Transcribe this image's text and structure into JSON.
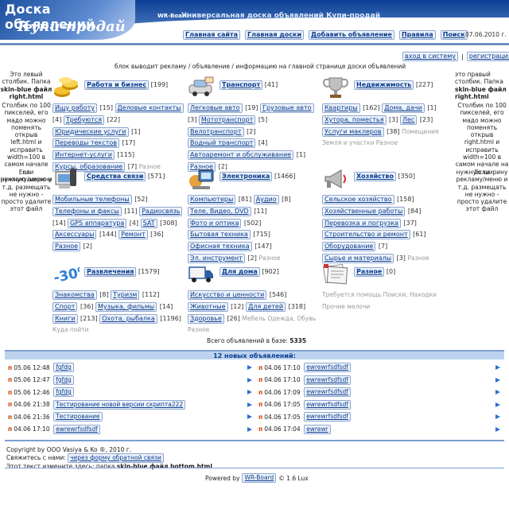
{
  "header": {
    "logo_line1": "Доска объявлений",
    "logo_line2": "Купи-продай",
    "brand": "WR-Board",
    "slogan": "Универсальная доска объявлений Купи-продай",
    "date": "07.06.2010 г.",
    "nav": [
      "Главная сайта",
      "Главная доски",
      "Добавить объявление",
      "Правила",
      "Поиск"
    ]
  },
  "auth": {
    "login": "вход в систему",
    "sep": "|",
    "register": "регистрация"
  },
  "left_column": {
    "text1": "Это левый\nстолбик. Папка\nskin-blue файл\nright.html",
    "text2": "Столбик по 100\nпикселей, его\nмадо можно\nпоменять открыв\nleft.html и\nисправить\nwidth=100 в\nсамом начале на\nнужную ширину",
    "text3": "Если\nрекламу/меню и\nт.д. размещать\nне нужно -\nпросто удалите\nэтот файл"
  },
  "right_column": {
    "text1": "это правый\nстолбик. Папка\nskin-blue файл\nright.html",
    "text2": "Столбик по 100\nпикселей, его\nмадо можно\nпоменять открыв\nright.html и\nисправить\nwidth=100 в\nсамом начале на\nнужную ширину",
    "text3": "Если\nрекламу/меню и\nт.д. размещать\nне нужно -\nпросто удалите\nэтот файл"
  },
  "banner": "блок выводит рекламу / объявление / информацию на главной странице доски объявлений",
  "categories": [
    {
      "title": "Работа и бизнес",
      "count": "[199]",
      "icon": "coins-icon",
      "subs": [
        [
          "Ищу работу",
          "[15]"
        ],
        [
          "Деловые контакты",
          "[4]"
        ],
        [
          "Требуются",
          "[22]"
        ],
        [
          "Юридические услуги",
          "[1]"
        ],
        [
          "Переводы текстов",
          "[17]"
        ],
        [
          "Интернет-услуги",
          "[115]"
        ],
        [
          "Курсы, образование",
          "[7]"
        ]
      ],
      "empty": [
        "Разное"
      ]
    },
    {
      "title": "Транспорт",
      "count": "[41]",
      "icon": "transport-icon",
      "subs": [
        [
          "Легковые авто",
          "[19]"
        ],
        [
          "Грузовые авто",
          "[3]"
        ],
        [
          "Мототранспорт",
          "[5]"
        ],
        [
          "Велотранспорт",
          "[2]"
        ],
        [
          "Водный транспорт",
          "[4]"
        ],
        [
          "Автоаремонт и обслуживание",
          "[1]"
        ],
        [
          "Разное",
          "[2]"
        ]
      ],
      "empty": []
    },
    {
      "title": "Недвижимость",
      "count": "[227]",
      "icon": "trophy-icon",
      "subs": [
        [
          "Квартиры",
          "[162]"
        ],
        [
          "Дома, дачи",
          "[1]"
        ],
        [
          "Хутора, поместья",
          "[3]"
        ],
        [
          "Лес",
          "[23]"
        ],
        [
          "Услуги маклеров",
          "[38]"
        ]
      ],
      "empty": [
        "Помещения",
        "Земля и участки",
        "Разное"
      ]
    },
    {
      "title": "Средства связи",
      "count": "[571]",
      "icon": "communication-icon",
      "subs": [
        [
          "Мобильные телефоны",
          "[52]"
        ],
        [
          "Телефоны и факсы",
          "[11]"
        ],
        [
          "Радиосвязь",
          "[14]"
        ],
        [
          "GPS аппаратура",
          "[4]"
        ],
        [
          "SAT",
          "[308]"
        ],
        [
          "Аксессуары",
          "[144]"
        ],
        [
          "Ремонт",
          "[36]"
        ],
        [
          "Разное",
          "[2]"
        ]
      ],
      "empty": []
    },
    {
      "title": "Электроника",
      "count": "[1466]",
      "icon": "electronics-icon",
      "subs": [
        [
          "Компьютеры",
          "[81]"
        ],
        [
          "Аудио",
          "[8]"
        ],
        [
          "Теле, Видео, DVD",
          "[11]"
        ],
        [
          "Фото и оптика",
          "[502]"
        ],
        [
          "Бытовая техника",
          "[715]"
        ],
        [
          "Офисная техника",
          "[147]"
        ],
        [
          "Эл. инструмент",
          "[2]"
        ]
      ],
      "empty": [
        "Разное"
      ]
    },
    {
      "title": "Хозяйство",
      "count": "[350]",
      "icon": "megaphone-icon",
      "subs": [
        [
          "Сельское хозяйство",
          "[158]"
        ],
        [
          "Хозяйственные работы",
          "[84]"
        ],
        [
          "Перевозка и погрузка",
          "[37]"
        ],
        [
          "Строительство и ремонт",
          "[61]"
        ],
        [
          "Оборудование",
          "[7]"
        ],
        [
          "Сырье и материалы",
          "[3]"
        ]
      ],
      "empty": [
        "Разное"
      ]
    },
    {
      "title": "Развлечения",
      "count": "[1579]",
      "icon": "percent-icon",
      "subs": [
        [
          "Знакомства",
          "[8]"
        ],
        [
          "Туризм",
          "[112]"
        ],
        [
          "Спорт",
          "[36]"
        ],
        [
          "Музыка, фильмы",
          "[14]"
        ],
        [
          "Книги",
          "[213]"
        ],
        [
          "Охота, рыбалка",
          "[1196]"
        ]
      ],
      "empty": [
        "Куда пойти"
      ]
    },
    {
      "title": "Для дома",
      "count": "[902]",
      "icon": "truck-icon",
      "subs": [
        [
          "Искусство и ценности",
          "[546]"
        ],
        [
          "Животные",
          "[12]"
        ],
        [
          "Для детей",
          "[318]"
        ],
        [
          "Здоровье",
          "[26]"
        ]
      ],
      "empty": [
        "Мебель",
        "Одежда, Обувь",
        "Разное"
      ]
    },
    {
      "title": "Разное",
      "count": "[0]",
      "icon": "newspaper-icon",
      "subs": [],
      "empty": [
        "Требуется помощь",
        "Поиски, Находки",
        "Прочие мелочи"
      ]
    }
  ],
  "total": {
    "label": "Всего объявлений в базе:",
    "value": "5335"
  },
  "new_ads": {
    "header": "12 новых объявлений:",
    "left": [
      [
        "05.06 12:48",
        "fgfdg"
      ],
      [
        "05.06 12:47",
        "fgfdg"
      ],
      [
        "05.06 12:46",
        "fgfdg"
      ],
      [
        "04.06 21:38",
        "Тестирование новой версии скрипта222"
      ],
      [
        "04.06 21:36",
        "Тестирование"
      ],
      [
        "04.06 17:10",
        "ewrewrfsdfsdf"
      ]
    ],
    "right": [
      [
        "04.06 17:10",
        "ewrewrfsdfsdf"
      ],
      [
        "04.06 17:10",
        "ewrewrfsdfsdf"
      ],
      [
        "04.06 17:09",
        "ewrewrfsdfsdf"
      ],
      [
        "04.06 17:05",
        "ewrewrfsdfsdf"
      ],
      [
        "04.06 17:05",
        "ewrewrfsdfsdf"
      ],
      [
        "04.06 17:04",
        "ewrewr"
      ]
    ]
  },
  "footer": {
    "copyright": "Copyright by ООО Vasiya & Ko ®, 2010 г.",
    "contact_label": "Свяжитесь с нами:",
    "contact_link": "через форму обратной связи",
    "note_prefix": "Этот текст измените здесь: папка ",
    "note_bold": "skin-blue файл bottom.html",
    "powered_by": "Powered by",
    "powered_brand": "WR-Board",
    "version": "© 1.6 Lux"
  },
  "colors": {
    "accent": "#0a3d8f",
    "header_band": "#0c3f95",
    "new_mark": "#d04000"
  }
}
